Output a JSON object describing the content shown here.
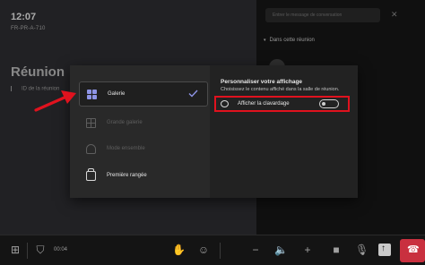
{
  "stage": {
    "time": "12:07",
    "code": "FR-PR-A-710",
    "meeting_title": "Réunion av",
    "meeting_id": "ID de la réunion"
  },
  "side_panel": {
    "search_placeholder": "Entrer le message de conversation",
    "section_label": "Dans cette réunion"
  },
  "dialog": {
    "options": [
      {
        "label": "Galerie",
        "icon": "gallery-grid-icon",
        "state": "selected"
      },
      {
        "label": "Grande galerie",
        "icon": "large-gallery-icon",
        "state": "disabled"
      },
      {
        "label": "Mode ensemble",
        "icon": "together-mode-icon",
        "state": "disabled"
      },
      {
        "label": "Première rangée",
        "icon": "front-row-icon",
        "state": "enabled"
      }
    ],
    "panel_title": "Personnaliser votre affichage",
    "panel_description": "Choisissez le contenu affiché dans la salle de réunion.",
    "chat_toggle_label": "Afficher la clavardage",
    "chat_toggle_on": false
  },
  "toolbar": {
    "call_time": "00:04"
  },
  "colors": {
    "accent": "#8e94e6",
    "highlight": "#e0121e",
    "hangup": "#c9303f"
  }
}
